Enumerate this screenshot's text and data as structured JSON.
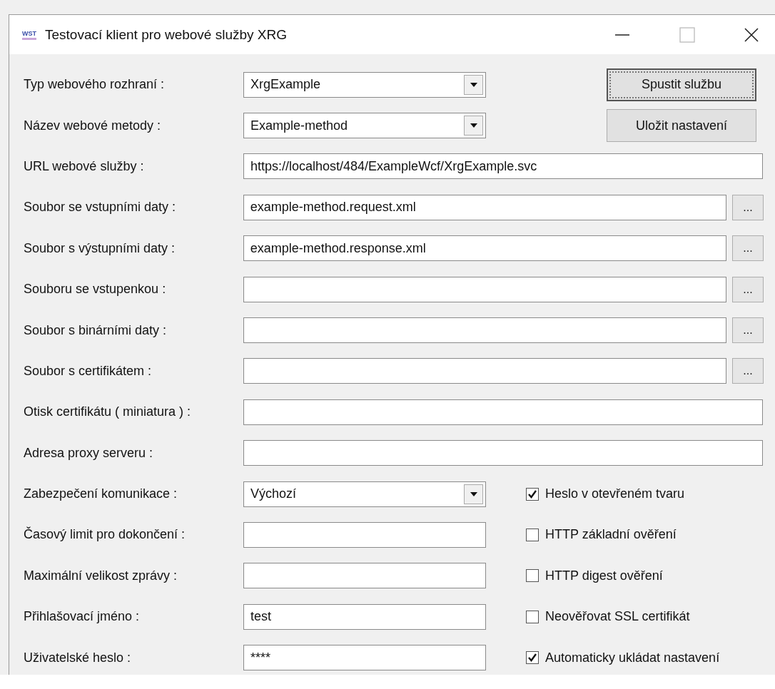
{
  "window": {
    "title": "Testovací klient pro webové služby XRG",
    "app_icon_text": "WST"
  },
  "rows": [
    {
      "label": "Typ webového rozhraní :",
      "kind": "select",
      "value": "XrgExample",
      "button": {
        "label": "Spustit službu",
        "focused": true
      }
    },
    {
      "label": "Název webové metody :",
      "kind": "select",
      "value": "Example-method",
      "button": {
        "label": "Uložit nastavení",
        "focused": false
      }
    },
    {
      "label": "URL webové služby :",
      "kind": "text",
      "value": "https://localhost/484/ExampleWcf/XrgExample.svc"
    },
    {
      "label": "Soubor se vstupními daty :",
      "kind": "file",
      "value": "example-method.request.xml",
      "browse": "..."
    },
    {
      "label": "Soubor s výstupními daty :",
      "kind": "file",
      "value": "example-method.response.xml",
      "browse": "..."
    },
    {
      "label": "Souboru se vstupenkou :",
      "kind": "file",
      "browse": "..."
    },
    {
      "label": "Soubor s binárními daty :",
      "kind": "file",
      "browse": "..."
    },
    {
      "label": "Soubor s certifikátem :",
      "kind": "file",
      "browse": "..."
    },
    {
      "label": "Otisk certifikátu ( miniatura ) :",
      "kind": "text"
    },
    {
      "label": "Adresa proxy serveru :",
      "kind": "text"
    },
    {
      "label": "Zabezpečení komunikace :",
      "kind": "select",
      "value": "Výchozí",
      "checkbox": {
        "label": "Heslo v otevřeném tvaru",
        "checked": true
      }
    },
    {
      "label": "Časový limit pro dokončení :",
      "kind": "short",
      "checkbox": {
        "label": "HTTP základní ověření",
        "checked": false
      }
    },
    {
      "label": "Maximální velikost zprávy :",
      "kind": "short",
      "checkbox": {
        "label": "HTTP digest ověření",
        "checked": false
      }
    },
    {
      "label": "Přihlašovací jméno :",
      "kind": "short",
      "value": "test",
      "checkbox": {
        "label": "Neověřovat SSL certifikát",
        "checked": false
      }
    },
    {
      "label": "Uživatelské heslo :",
      "kind": "short",
      "value": "****",
      "checkbox": {
        "label": "Automaticky ukládat nastavení",
        "checked": true
      }
    }
  ]
}
